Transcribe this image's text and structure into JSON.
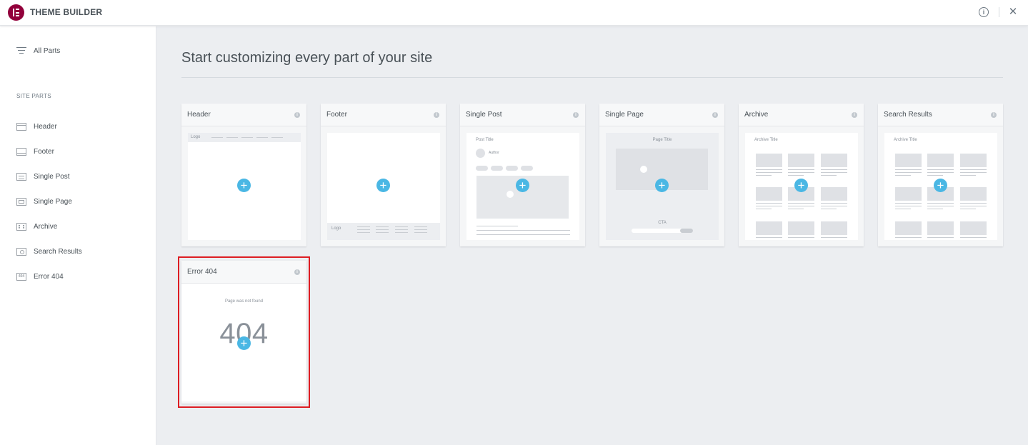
{
  "app": {
    "title": "THEME BUILDER"
  },
  "sidebar": {
    "all_parts_label": "All Parts",
    "section_title": "SITE PARTS",
    "items": [
      {
        "label": "Header",
        "icon": "header-icon"
      },
      {
        "label": "Footer",
        "icon": "footer-icon"
      },
      {
        "label": "Single Post",
        "icon": "single-post-icon"
      },
      {
        "label": "Single Page",
        "icon": "single-page-icon"
      },
      {
        "label": "Archive",
        "icon": "archive-icon"
      },
      {
        "label": "Search Results",
        "icon": "search-results-icon"
      },
      {
        "label": "Error 404",
        "icon": "error-404-icon"
      }
    ]
  },
  "main": {
    "title": "Start customizing every part of your site",
    "cards": [
      {
        "title": "Header",
        "preview": {
          "logo": "Logo"
        }
      },
      {
        "title": "Footer",
        "preview": {
          "logo": "Logo"
        }
      },
      {
        "title": "Single Post",
        "preview": {
          "post_title": "Post Title",
          "author": "Author"
        }
      },
      {
        "title": "Single Page",
        "preview": {
          "page_title": "Page Title",
          "cta": "CTA"
        }
      },
      {
        "title": "Archive",
        "preview": {
          "archive_title": "Archive Title"
        }
      },
      {
        "title": "Search Results",
        "preview": {
          "archive_title": "Archive Title"
        }
      },
      {
        "title": "Error 404",
        "preview": {
          "message": "Page was not found",
          "code": "404"
        }
      }
    ],
    "add_symbol": "+",
    "info_symbol": "i"
  },
  "colors": {
    "brand": "#92003b",
    "accent": "#4ab7e4",
    "highlight": "#dd1d23"
  }
}
